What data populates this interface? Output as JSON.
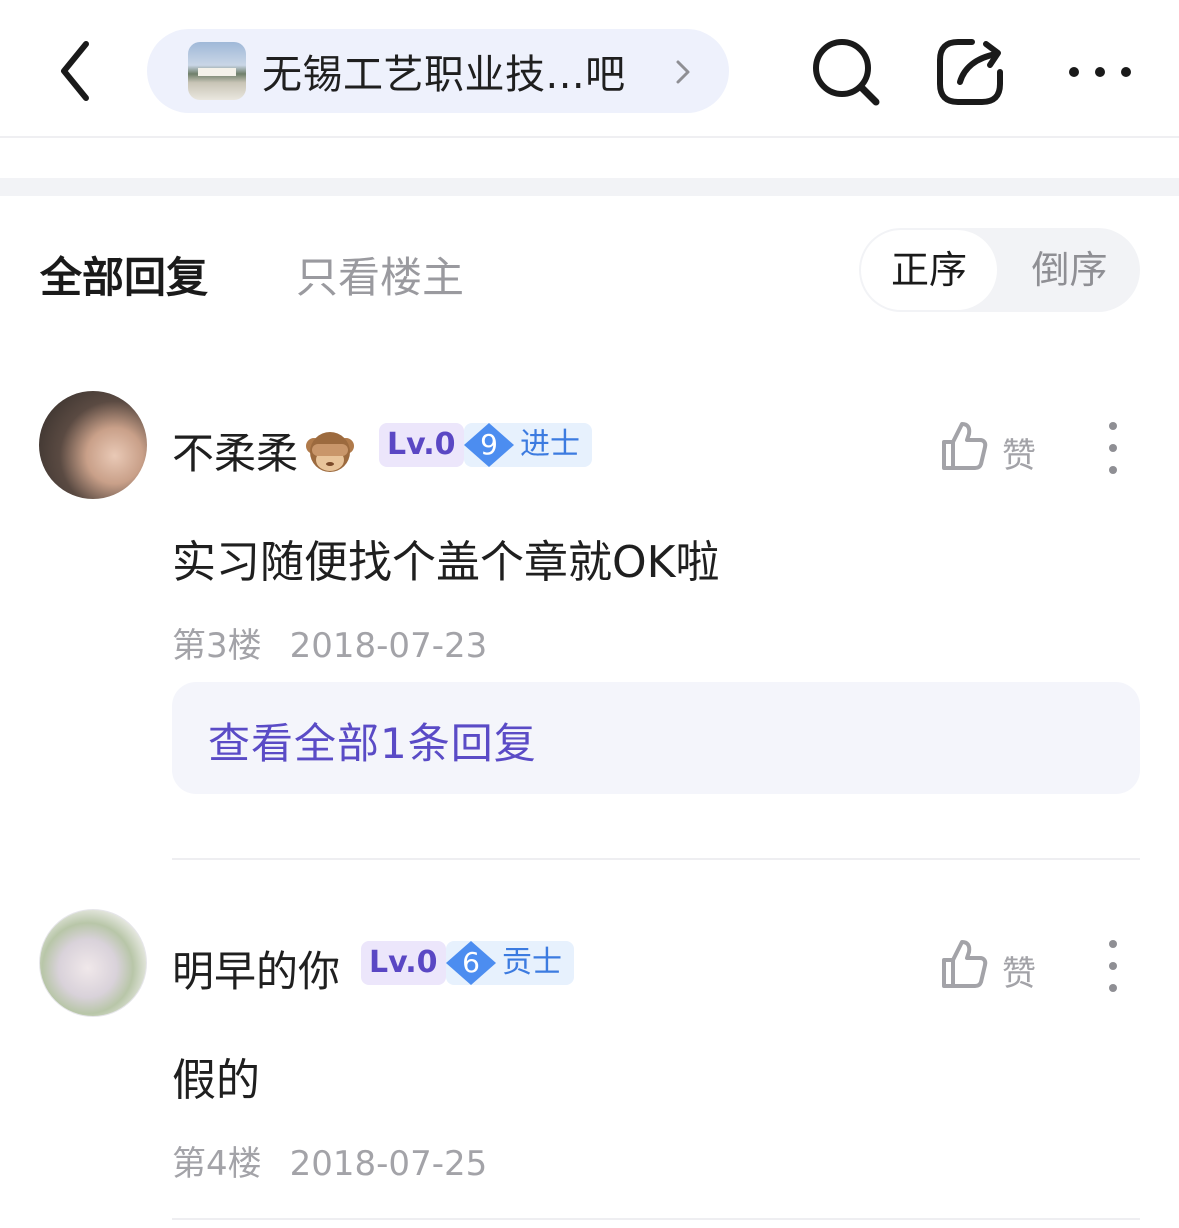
{
  "header": {
    "forum_name": "无锡工艺职业技...吧"
  },
  "tabs": {
    "all_replies": "全部回复",
    "op_only": "只看楼主"
  },
  "sort": {
    "ascending": "正序",
    "descending": "倒序",
    "selected": "正序"
  },
  "posts": [
    {
      "username": "不柔柔",
      "level": "Lv.0",
      "rank_num": "9",
      "rank_title": "进士",
      "like_label": "赞",
      "content": "实习随便找个盖个章就OK啦",
      "floor": "第3楼",
      "date": "2018-07-23",
      "reply_link": "查看全部1条回复"
    },
    {
      "username": "明早的你",
      "level": "Lv.0",
      "rank_num": "6",
      "rank_title": "贡士",
      "like_label": "赞",
      "content": "假的",
      "floor": "第4楼",
      "date": "2018-07-25"
    }
  ],
  "colors": {
    "accent": "#5a4bc6",
    "pill_bg": "#eef1fc",
    "rank_blue": "#3c7be0"
  },
  "icons": [
    "back-arrow-icon",
    "search-icon",
    "share-icon",
    "more-icon",
    "thumbs-up-icon",
    "kebab-icon",
    "see-no-evil-monkey-emoji"
  ]
}
